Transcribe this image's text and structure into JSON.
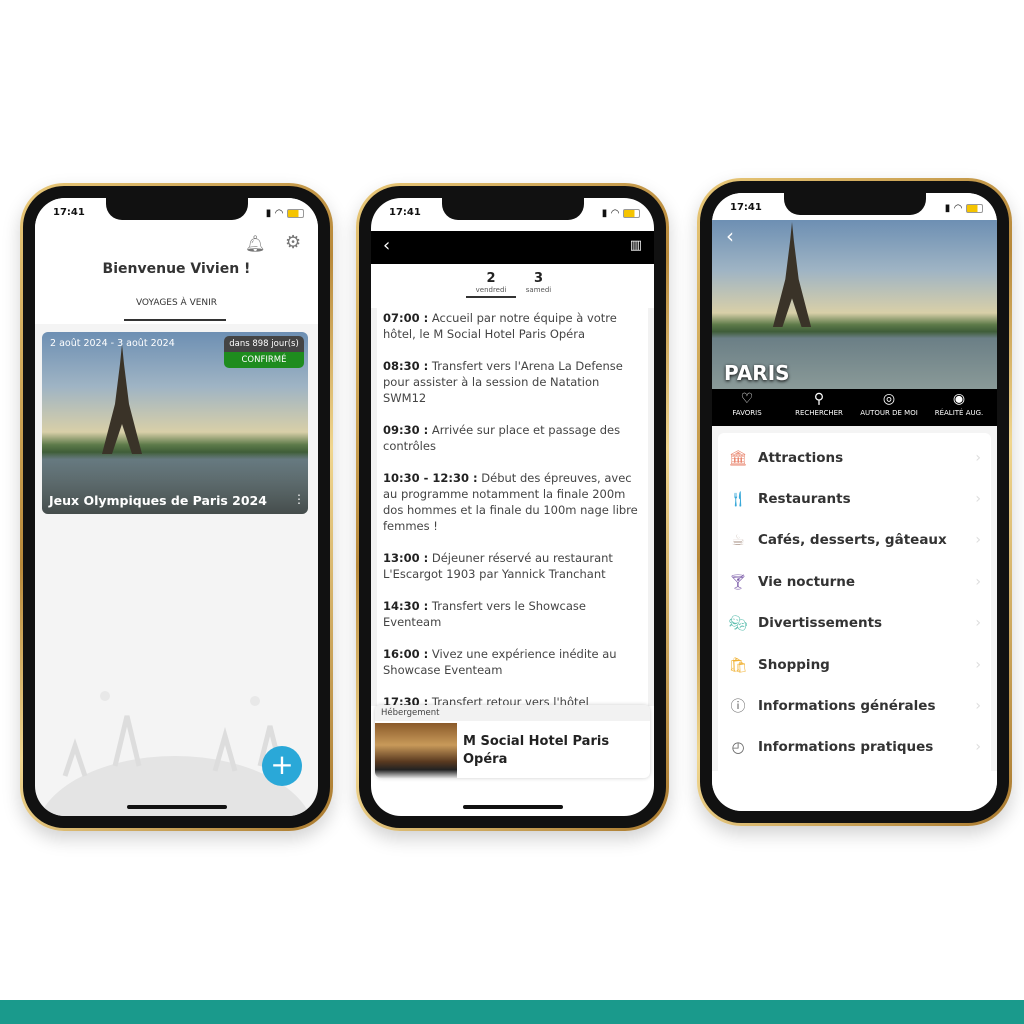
{
  "status": {
    "time": "17:41"
  },
  "phone1": {
    "title": "Bienvenue Vivien !",
    "tab": "VOYAGES À VENIR",
    "trip": {
      "dates": "2 août 2024 - 3 août 2024",
      "countdown": "dans 898 jour(s)",
      "status": "CONFIRMÉ",
      "name": "Jeux Olympiques de Paris 2024"
    },
    "icons": [
      "bell-icon",
      "gear-icon",
      "plus-icon",
      "more-vertical-icon"
    ],
    "colors": {
      "confirmed": "#1e8c1e",
      "fab": "#2aa8d8"
    }
  },
  "phone2": {
    "days": [
      {
        "num": "2",
        "name": "vendredi"
      },
      {
        "num": "3",
        "name": "samedi"
      }
    ],
    "schedule": [
      {
        "time": "07:00 :",
        "text": "Accueil par notre équipe à votre hôtel, le M Social Hotel Paris Opéra"
      },
      {
        "time": "08:30 :",
        "text": "Transfert vers l'Arena La Defense pour assister à la session de Natation SWM12"
      },
      {
        "time": "09:30 :",
        "text": "Arrivée sur place et passage des contrôles"
      },
      {
        "time": "10:30 - 12:30 :",
        "text": "Début des épreuves, avec au programme notamment la finale 200m dos hommes et la finale du 100m nage libre femmes !"
      },
      {
        "time": "13:00 :",
        "text": "Déjeuner réservé au restaurant L'Escargot 1903 par Yannick Tranchant"
      },
      {
        "time": "14:30 :",
        "text": "Transfert vers le Showcase Eventeam"
      },
      {
        "time": "16:00 :",
        "text": "Vivez une expérience inédite au Showcase Eventeam"
      },
      {
        "time": "17:30 :",
        "text": "Transfert retour vers l'hôtel"
      }
    ],
    "lodging": {
      "label": "Hébergement",
      "name": "M Social Hotel Paris Opéra"
    }
  },
  "phone3": {
    "city": "PARIS",
    "nav": [
      {
        "label": "FAVORIS",
        "icon": "heart-icon"
      },
      {
        "label": "RECHERCHER",
        "icon": "search-icon"
      },
      {
        "label": "AUTOUR DE MOI",
        "icon": "radar-icon"
      },
      {
        "label": "RÉALITÉ AUG.",
        "icon": "eye-icon"
      }
    ],
    "categories": [
      {
        "label": "Attractions",
        "icon": "monument-icon",
        "color": "#e8826a"
      },
      {
        "label": "Restaurants",
        "icon": "cutlery-icon",
        "color": "#3aa9d9"
      },
      {
        "label": "Cafés, desserts, gâteaux",
        "icon": "coffee-icon",
        "color": "#b9a79c"
      },
      {
        "label": "Vie nocturne",
        "icon": "cocktail-icon",
        "color": "#7a5aa8"
      },
      {
        "label": "Divertissements",
        "icon": "masks-icon",
        "color": "#5fbfb0"
      },
      {
        "label": "Shopping",
        "icon": "bag-icon",
        "color": "#f0b030"
      },
      {
        "label": "Informations générales",
        "icon": "info-icon",
        "color": "#666"
      },
      {
        "label": "Informations pratiques",
        "icon": "compass-icon",
        "color": "#666"
      }
    ]
  },
  "footer_color": "#1a9a8c"
}
